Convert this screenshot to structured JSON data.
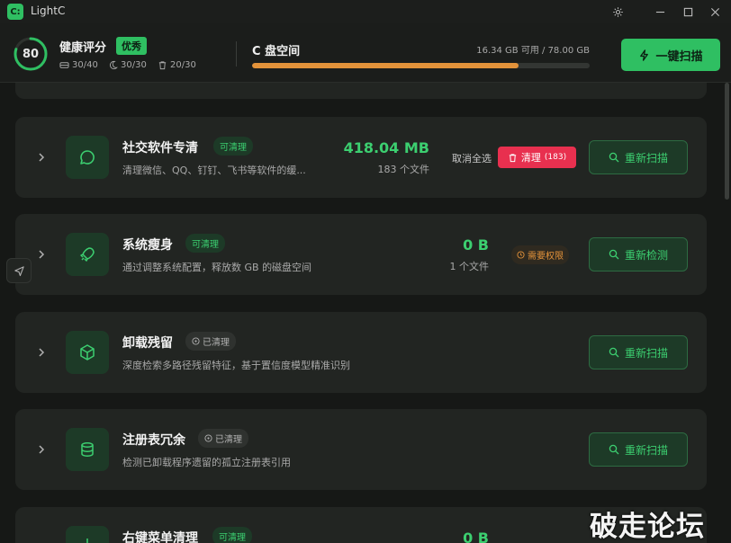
{
  "app": {
    "logo_text": "C:",
    "title": "LightC"
  },
  "window_controls": [
    "gear-icon",
    "minimize-icon",
    "maximize-icon",
    "close-icon"
  ],
  "health": {
    "score": "80",
    "score_value": 80,
    "title": "健康评分",
    "badge": "优秀",
    "stats": [
      {
        "icon": "disk-icon",
        "value": "30/40"
      },
      {
        "icon": "moon-icon",
        "value": "30/30"
      },
      {
        "icon": "trash-icon",
        "value": "20/30"
      }
    ]
  },
  "disk": {
    "title": "C 盘空间",
    "info": "16.34 GB 可用 / 78.00 GB",
    "used_fraction": 0.79
  },
  "scan_button": {
    "label": "一键扫描",
    "icon": "lightning-icon"
  },
  "cards": [
    {
      "title": "社交软件专清",
      "tag": "可清理",
      "tag_type": "green",
      "description": "清理微信、QQ、钉钉、飞书等软件的缓...",
      "size": "418.04 MB",
      "files": "183 个文件",
      "deselect": "取消全选",
      "clean_label": "清理",
      "clean_count": "(183)",
      "button": "重新扫描",
      "icon": "chat-icon"
    },
    {
      "title": "系统瘦身",
      "tag": "可清理",
      "tag_type": "green",
      "description": "通过调整系统配置，释放数 GB 的磁盘空间",
      "size": "0 B",
      "files": "1 个文件",
      "permission": "需要权限",
      "button": "重新检测",
      "icon": "rocket-icon"
    },
    {
      "title": "卸载残留",
      "tag": "已清理",
      "tag_type": "gray",
      "description": "深度检索多路径残留特征，基于置信度模型精准识别",
      "button": "重新扫描",
      "icon": "cube-icon"
    },
    {
      "title": "注册表冗余",
      "tag": "已清理",
      "tag_type": "gray",
      "description": "检测已卸载程序遗留的孤立注册表引用",
      "button": "重新扫描",
      "icon": "database-icon"
    },
    {
      "title": "右键菜单清理",
      "tag": "可清理",
      "tag_type": "green",
      "size": "0 B",
      "icon": "sparkle-icon"
    }
  ],
  "watermark": "破走论坛",
  "colors": {
    "accent": "#2fbf62",
    "accent_text": "#3ccf70",
    "danger": "#e8304f",
    "warning": "#e3923a",
    "background": "#161816",
    "card": "#222522"
  }
}
